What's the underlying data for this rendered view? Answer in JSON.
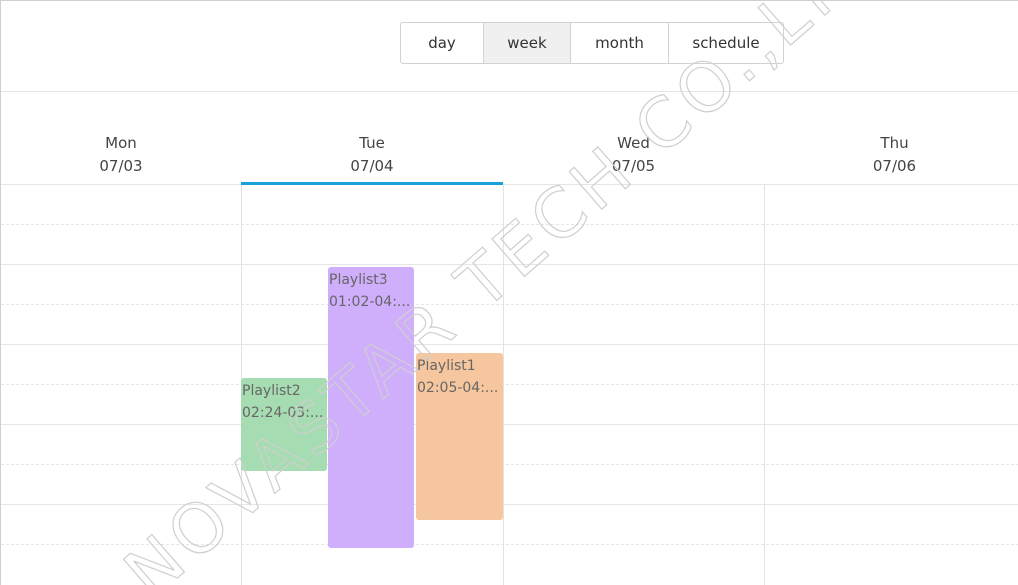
{
  "views": [
    {
      "label": "day",
      "active": false
    },
    {
      "label": "week",
      "active": true
    },
    {
      "label": "month",
      "active": false
    },
    {
      "label": "schedule",
      "active": false
    }
  ],
  "days": [
    {
      "name": "Mon",
      "date": "07/03",
      "selected": false
    },
    {
      "name": "Tue",
      "date": "07/04",
      "selected": true
    },
    {
      "name": "Wed",
      "date": "07/05",
      "selected": false
    },
    {
      "name": "Thu",
      "date": "07/06",
      "selected": false
    }
  ],
  "events": [
    {
      "title": "Playlist2",
      "time": "02:24-03:...",
      "color": "#a6dcb1"
    },
    {
      "title": "Playlist3",
      "time": "01:02-04:...",
      "color": "#cfaefc"
    },
    {
      "title": "Playlist1",
      "time": "02:05-04:...",
      "color": "#f6c69e"
    }
  ],
  "watermark": "NOVASTAR TECH CO.,LTD",
  "accent_color": "#1a9fd6"
}
